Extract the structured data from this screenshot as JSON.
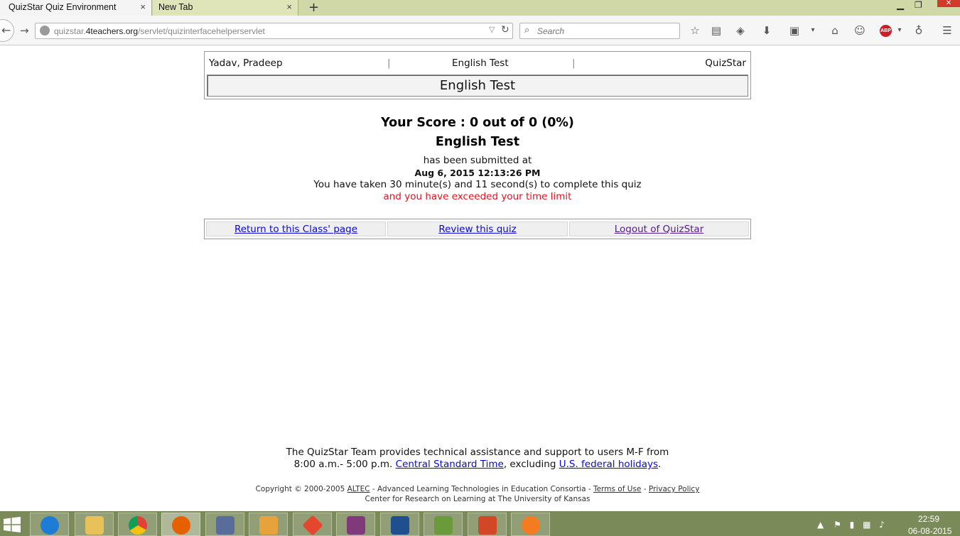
{
  "browser": {
    "tabs": [
      {
        "label": "QuizStar Quiz Environment"
      },
      {
        "label": "New Tab"
      }
    ],
    "tab_close_glyph": "×",
    "new_tab_glyph": "+",
    "url_prefix": "quizstar.",
    "url_domain": "4teachers.org",
    "url_path": "/servlet/quizinterfacehelperservlet",
    "search_placeholder": "Search",
    "abp_label": "ABP"
  },
  "header": {
    "user_name": "Yadav, Pradeep",
    "separator": "|",
    "test_name": "English Test",
    "app_name": "QuizStar",
    "title": "English Test"
  },
  "result": {
    "score": "Your Score : 0 out of 0 (0%)",
    "quiz_name": "English Test",
    "submitted_text": "has been submitted at",
    "submitted_time": "Aug 6, 2015 12:13:26 PM",
    "duration_text": "You have taken 30 minute(s) and 11 second(s) to complete this quiz",
    "warning_text": "and you have exceeded your time limit"
  },
  "links": {
    "return_label": "Return to this Class' page",
    "review_label": "Review this quiz",
    "logout_label": "Logout of QuizStar"
  },
  "footer": {
    "support_line1": "The QuizStar Team provides technical assistance and support to users M-F from",
    "support_line2_pre": "8:00 a.m.- 5:00 p.m. ",
    "cst_link": "Central Standard Time",
    "support_line2_mid": ", excluding ",
    "holidays_link": "U.S. federal holidays",
    "support_line2_post": ".",
    "copyright_pre": "Copyright © 2000-2005 ",
    "altec_link": "ALTEC",
    "copyright_mid": " - Advanced Learning Technologies in Education Consortia - ",
    "terms_link": "Terms of Use",
    "dash": " - ",
    "privacy_link": "Privacy Policy",
    "center_line": "Center for Research on Learning at The University of Kansas"
  },
  "taskbar": {
    "time": "22:59",
    "date": "06-08-2015",
    "apps": [
      "internet-explorer",
      "file-explorer",
      "chrome",
      "firefox",
      "calculator",
      "outlook",
      "git",
      "onenote",
      "virtualbox",
      "chart-app",
      "powerpoint",
      "pdf-app"
    ]
  },
  "colors": {
    "link": "#0a0ad2",
    "visited_link": "#551a8b",
    "warning": "#e0141e",
    "taskbar": "#7a8a58",
    "tabbar": "#cfd8a6"
  }
}
